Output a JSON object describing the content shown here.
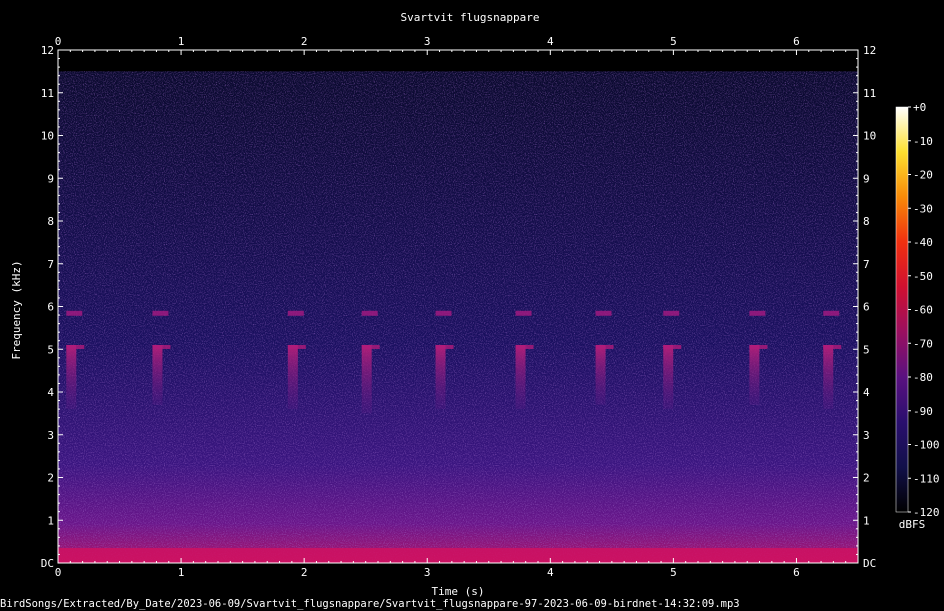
{
  "chart_data": {
    "type": "heatmap",
    "title": "Svartvit flugsnappare",
    "xlabel": "Time (s)",
    "ylabel": "Frequency (kHz)",
    "footer": "BirdSongs/Extracted/By_Date/2023-06-09/Svartvit_flugsnappare/Svartvit_flugsnappare-97-2023-06-09-birdnet-14:32:09.mp3",
    "xlim": [
      0,
      6.5
    ],
    "ylim": [
      0,
      12
    ],
    "x_ticks": [
      "0",
      "1",
      "2",
      "3",
      "4",
      "5",
      "6"
    ],
    "y_ticks": [
      "DC",
      "1",
      "2",
      "3",
      "4",
      "5",
      "6",
      "7",
      "8",
      "9",
      "10",
      "11",
      "12"
    ],
    "colorbar": {
      "label": "dBFS",
      "range": [
        -120,
        0
      ],
      "ticks": [
        "+0",
        "-10",
        "-20",
        "-30",
        "-40",
        "-50",
        "-60",
        "-70",
        "-80",
        "-90",
        "-100",
        "-110",
        "-120"
      ],
      "colors": [
        "#000000",
        "#12104a",
        "#2a0f6e",
        "#5a1180",
        "#9a1060",
        "#d01030",
        "#f03010",
        "#f88a08",
        "#fde030",
        "#ffffff"
      ]
    },
    "calls": [
      {
        "t": 0.1,
        "low_khz": 3.6,
        "high_khz": 5.9
      },
      {
        "t": 0.8,
        "low_khz": 3.7,
        "high_khz": 5.9
      },
      {
        "t": 1.9,
        "low_khz": 3.6,
        "high_khz": 5.9
      },
      {
        "t": 2.5,
        "low_khz": 3.5,
        "high_khz": 5.9
      },
      {
        "t": 3.1,
        "low_khz": 3.6,
        "high_khz": 5.9
      },
      {
        "t": 3.75,
        "low_khz": 3.6,
        "high_khz": 5.9
      },
      {
        "t": 4.4,
        "low_khz": 3.7,
        "high_khz": 5.9
      },
      {
        "t": 4.95,
        "low_khz": 3.6,
        "high_khz": 5.9
      },
      {
        "t": 5.65,
        "low_khz": 3.7,
        "high_khz": 5.9
      },
      {
        "t": 6.25,
        "low_khz": 3.6,
        "high_khz": 5.9
      }
    ],
    "background_level_db": -100,
    "low_freq_level_db": -70,
    "signal_cutoff_khz": 11.5
  }
}
